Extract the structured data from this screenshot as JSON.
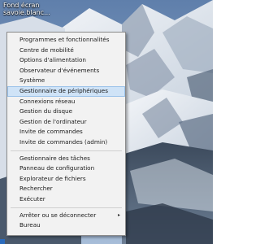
{
  "desktop": {
    "icon_label_line1": "Fond écran",
    "icon_label_line2": "savoie.blanc..."
  },
  "context_menu": {
    "group1": [
      "Programmes et fonctionnalités",
      "Centre de mobilité",
      "Options d'alimentation",
      "Observateur d'événements",
      "Système",
      "Gestionnaire de périphériques",
      "Connexions réseau",
      "Gestion du disque",
      "Gestion de l'ordinateur",
      "Invite de commandes",
      "Invite de commandes (admin)"
    ],
    "group2": [
      "Gestionnaire des tâches",
      "Panneau de configuration",
      "Explorateur de fichiers",
      "Rechercher",
      "Exécuter"
    ],
    "group3": [
      "Arrêter ou se déconnecter",
      "Bureau"
    ],
    "highlighted_item": "Gestionnaire de périphériques",
    "submenu_arrow": "▸"
  },
  "colors": {
    "menu_background": "#f2f2f2",
    "highlight": "#cfe3f7",
    "sky": "#7a96bb"
  }
}
